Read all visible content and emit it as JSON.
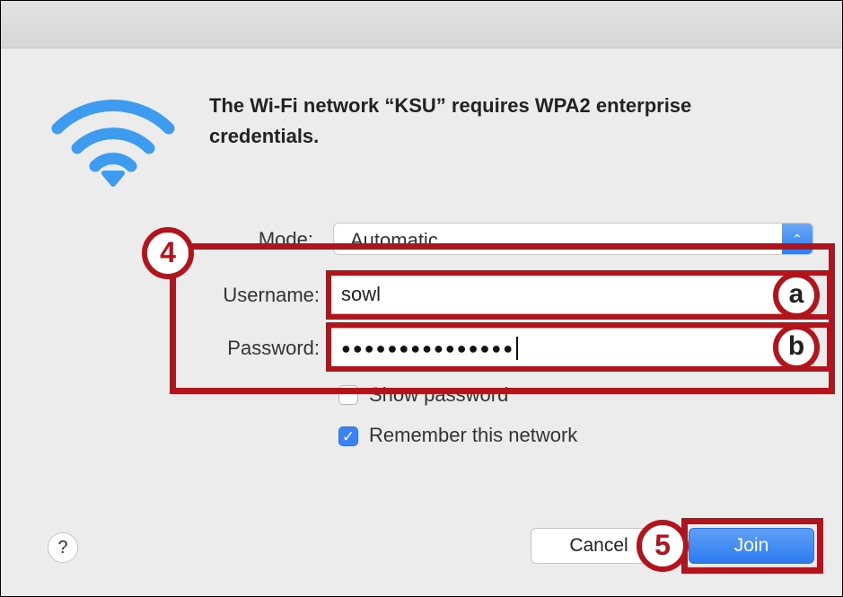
{
  "dialog": {
    "message": "The Wi-Fi network “KSU” requires WPA2 enterprise credentials.",
    "mode_label": "Mode:",
    "mode_value": "Automatic",
    "username_label": "Username:",
    "username_value": "sowl",
    "password_label": "Password:",
    "password_value": "●●●●●●●●●●●●●●●",
    "show_password_label": "Show password",
    "remember_label": "Remember this network",
    "help_label": "?",
    "cancel_label": "Cancel",
    "join_label": "Join",
    "mode_stepper_icon": "⌃"
  },
  "annotations": {
    "step_4": "4",
    "step_5": "5",
    "marker_a": "a",
    "marker_b": "b",
    "highlight_color": "#b3141b"
  },
  "colors": {
    "accent": "#3a82f6",
    "wifi": "#3d9bf0"
  }
}
